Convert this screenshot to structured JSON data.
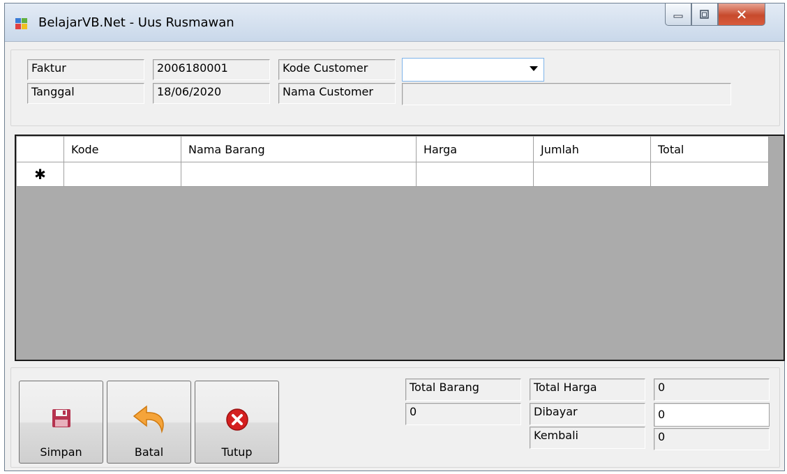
{
  "window": {
    "title": "BelajarVB.Net - Uus Rusmawan"
  },
  "header": {
    "faktur_label": "Faktur",
    "faktur_value": "2006180001",
    "tanggal_label": "Tanggal",
    "tanggal_value": "18/06/2020",
    "kode_customer_label": "Kode Customer",
    "kode_customer_value": "",
    "nama_customer_label": "Nama Customer",
    "nama_customer_value": ""
  },
  "grid": {
    "columns": [
      "Kode",
      "Nama Barang",
      "Harga",
      "Jumlah",
      "Total"
    ],
    "new_row_marker": "✱"
  },
  "buttons": {
    "simpan": "Simpan",
    "batal": "Batal",
    "tutup": "Tutup"
  },
  "summary": {
    "total_barang_label": "Total Barang",
    "total_barang_value": "0",
    "total_harga_label": "Total Harga",
    "total_harga_value": "0",
    "dibayar_label": "Dibayar",
    "dibayar_value": "0",
    "kembali_label": "Kembali",
    "kembali_value": "0"
  },
  "icons": {
    "app": "app-icon",
    "minimize": "minimize-icon",
    "maximize": "maximize-icon",
    "close": "close-icon",
    "simpan": "floppy-disk-icon",
    "batal": "undo-arrow-icon",
    "tutup": "close-circle-icon",
    "dropdown": "chevron-down-icon",
    "new_row": "asterisk-icon"
  },
  "colors": {
    "grid_background": "#ababab",
    "close_button": "#c74a2c",
    "combo_border": "#7eb4ea"
  }
}
